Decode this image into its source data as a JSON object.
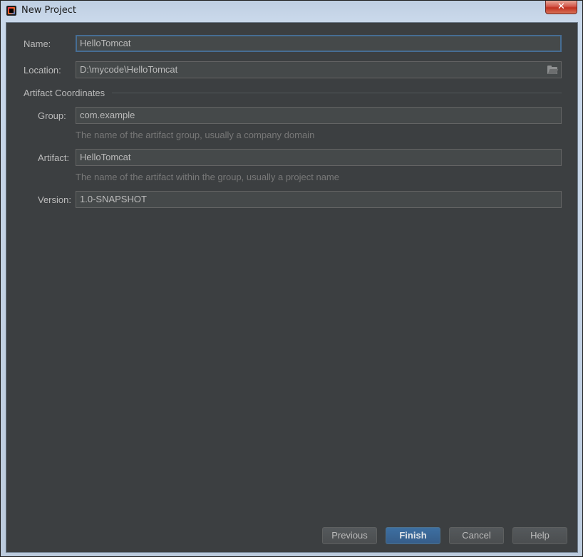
{
  "window": {
    "title": "New Project",
    "close_glyph": "✕"
  },
  "form": {
    "name": {
      "label": "Name:",
      "value": "HelloTomcat"
    },
    "location": {
      "label": "Location:",
      "value": "D:\\mycode\\HelloTomcat",
      "icon": "folder-icon"
    },
    "section_title": "Artifact Coordinates",
    "group": {
      "label": "Group:",
      "value": "com.example",
      "hint": "The name of the artifact group, usually a company domain"
    },
    "artifact": {
      "label": "Artifact:",
      "value": "HelloTomcat",
      "hint": "The name of the artifact within the group, usually a project name"
    },
    "version": {
      "label": "Version:",
      "value": "1.0-SNAPSHOT"
    }
  },
  "buttons": {
    "previous": "Previous",
    "finish": "Finish",
    "cancel": "Cancel",
    "help": "Help"
  },
  "colors": {
    "background": "#3c3f41",
    "field_bg": "#45494a",
    "focus_border": "#466d94",
    "primary_button": "#365d89"
  }
}
